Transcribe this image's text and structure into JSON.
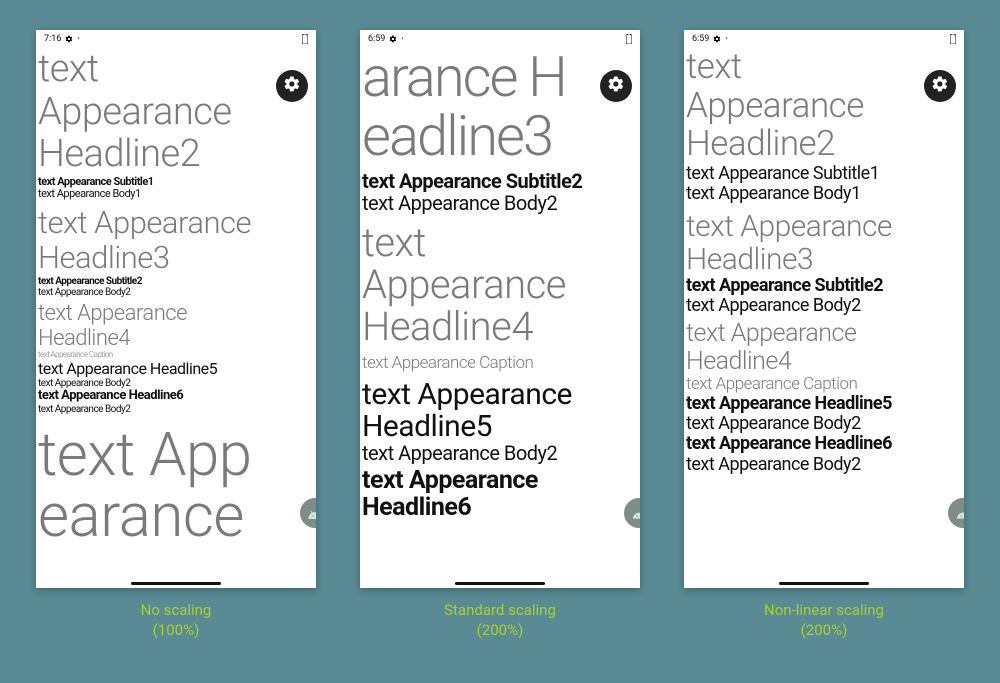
{
  "statusbar": {
    "time1": "7:16",
    "time2": "6:59",
    "time3": "6:59"
  },
  "captions": {
    "c1_line1": "No scaling",
    "c1_line2": "(100%)",
    "c2_line1": "Standard scaling",
    "c2_line2": "(200%)",
    "c3_line1": "Non-linear scaling",
    "c3_line2": "(200%)"
  },
  "t": {
    "h2_a": "text",
    "h2_b": "Appearance",
    "h2_c": "Headline2",
    "sub1": "text Appearance Subtitle1",
    "body1": "text Appearance Body1",
    "h3_a": "text Appearance",
    "h3_b": "Headline3",
    "sub2": "text Appearance Subtitle2",
    "body2": "text Appearance Body2",
    "h4_a": "text Appearance",
    "h4_b": "Headline4",
    "cap": "text Appearance Caption",
    "h5": "text Appearance Headline5",
    "h6": "text Appearance Headline6",
    "hbig_a": "text App",
    "hbig_b": "earance",
    "p2_h3_a": "arance H",
    "p2_h3_b": "eadline3",
    "p2_h4_a": "text",
    "p2_h4_b": "Appearance",
    "p2_h4_c": "Headline4",
    "p2_h5_a": "text Appearance",
    "p2_h5_b": "Headline5",
    "p2_h6_a": "text Appearance",
    "p2_h6_b": "Headline6"
  }
}
